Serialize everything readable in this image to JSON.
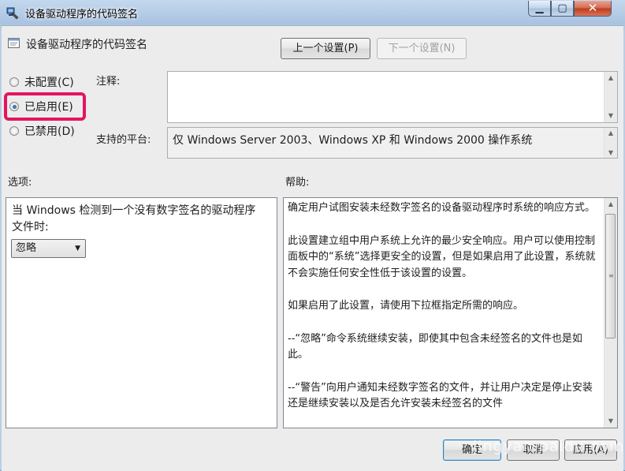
{
  "window": {
    "title": "设备驱动程序的代码签名"
  },
  "header": {
    "policy_name": "设备驱动程序的代码签名"
  },
  "nav": {
    "prev_setting": "上一个设置(P)",
    "next_setting": "下一个设置(N)"
  },
  "state": {
    "options": [
      {
        "label": "未配置(C)",
        "checked": false
      },
      {
        "label": "已启用(E)",
        "checked": true
      },
      {
        "label": "已禁用(D)",
        "checked": false
      }
    ]
  },
  "comment": {
    "label": "注释:",
    "value": ""
  },
  "platform": {
    "label": "支持的平台:",
    "value": "仅 Windows Server 2003、Windows XP 和 Windows 2000 操作系统"
  },
  "options_pane": {
    "label": "选项:",
    "description": "当 Windows 检测到一个没有数字签名的驱动程序文件时:",
    "dropdown_value": "忽略"
  },
  "help_pane": {
    "label": "帮助:",
    "paragraphs": [
      "确定用户试图安装未经数字签名的设备驱动程序时系统的响应方式。",
      "此设置建立组中用户系统上允许的最少安全响应。用户可以使用控制面板中的“系统”选择更安全的设置，但是如果启用了此设置，系统就不会实施任何安全性低于该设置的设置。",
      "如果启用了此设置，请使用下拉框指定所需的响应。",
      "--“忽略”命令系统继续安装，即使其中包含未经签名的文件也是如此。",
      "--“警告”向用户通知未经数字签名的文件，并让用户决定是停止安装还是继续安装以及是否允许安装未经签名的文件"
    ]
  },
  "buttons": {
    "ok": "确定",
    "cancel": "取消",
    "apply": "应用(A)"
  },
  "watermark": "jingyan.baidu.com",
  "colors": {
    "highlight": "#e1165f",
    "titlebar": "#b9cfe6",
    "dialog_bg": "#ececec"
  }
}
